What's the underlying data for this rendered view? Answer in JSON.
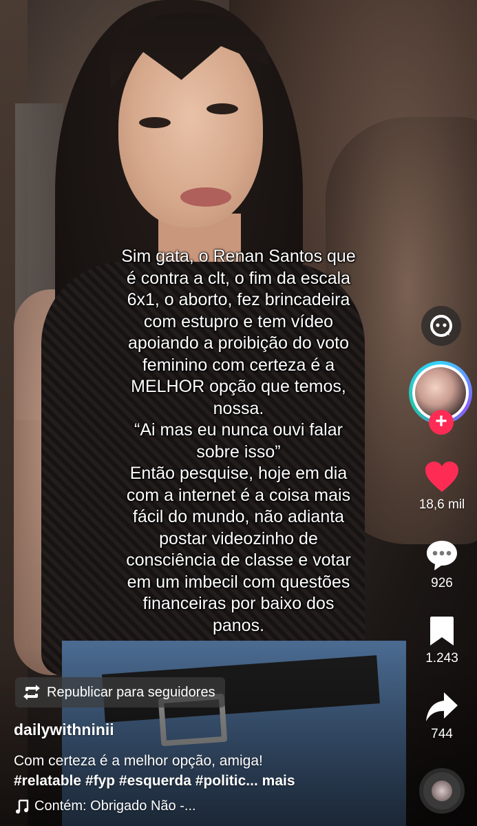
{
  "video": {
    "overlay_lines": [
      "Sim gata, o Renan Santos que",
      "é contra a clt, o fim da escala",
      "6x1, o aborto, fez brincadeira",
      "com estupro e tem vídeo",
      "apoiando a proibição do voto",
      "feminino com certeza é a",
      "MELHOR opção que temos,",
      "nossa.",
      "“Ai mas eu nunca ouvi falar",
      "sobre isso”",
      "Então pesquise, hoje em dia",
      "com a internet é a coisa mais",
      "fácil do mundo, não adianta",
      "postar videozinho de",
      "consciência de classe e votar",
      "em um imbecil com questões",
      "financeiras por baixo dos",
      "panos."
    ]
  },
  "rail": {
    "like_count": "18,6 mil",
    "comment_count": "926",
    "save_count": "1.243",
    "share_count": "744",
    "follow_label": "+",
    "accent_color": "#fe2c55"
  },
  "post": {
    "repost_label": "Republicar para seguidores",
    "username": "dailywithninii",
    "caption_text": "Com certeza é a melhor opção, amiga!",
    "hashtags": "#relatable #fyp #esquerda #politic...",
    "more_label": "mais",
    "music_label": "Contém: Obrigado Não -..."
  }
}
